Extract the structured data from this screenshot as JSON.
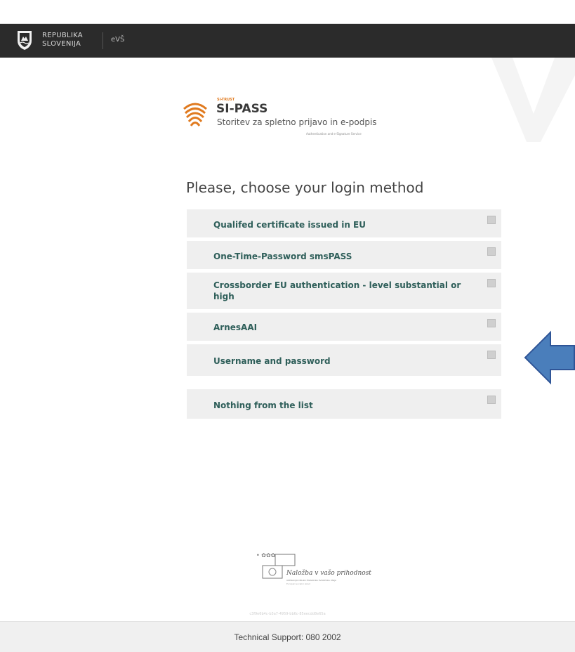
{
  "header": {
    "gov_name_line1": "REPUBLIKA",
    "gov_name_line2": "SLOVENIJA",
    "section": "eVŠ"
  },
  "brand": {
    "tag": "SI-TRUST",
    "name": "SI-PASS",
    "subtitle": "Storitev za spletno prijavo in e-podpis",
    "subtitle_en": "Authentication and e-Signature Service"
  },
  "login": {
    "heading": "Please, choose your login method",
    "methods": [
      {
        "label": "Qualifed certificate issued in EU"
      },
      {
        "label": "One-Time-Password smsPASS"
      },
      {
        "label": "Crossborder EU authentication - level substantial or high"
      },
      {
        "label": "ArnesAAI"
      },
      {
        "label": "Username and password"
      },
      {
        "label": "Nothing from the list"
      }
    ]
  },
  "footer": {
    "eu_logo_text": "Naložba v vašo prihodnost",
    "eu_logo_subtext": "OPERACIJO DELNO FINANCIRA EVROPSKA UNIJA",
    "eu_logo_sub2": "Evropski socialni sklad",
    "hash": "c3f9e6b4c-b3a7-4959-bb6c-85eecdd8e65a",
    "support": "Technical Support: 080 2002"
  },
  "colors": {
    "govbar": "#2b2b2b",
    "method_bg": "#efefef",
    "method_text": "#2f5f5a",
    "brand_orange": "#e07a1f",
    "arrow_fill": "#4a7ebb",
    "arrow_stroke": "#2f5597"
  },
  "icons": {
    "crest": "coat-of-arms-icon",
    "fingerprint": "fingerprint-icon",
    "info": "info-icon",
    "arrow": "left-arrow-icon"
  }
}
